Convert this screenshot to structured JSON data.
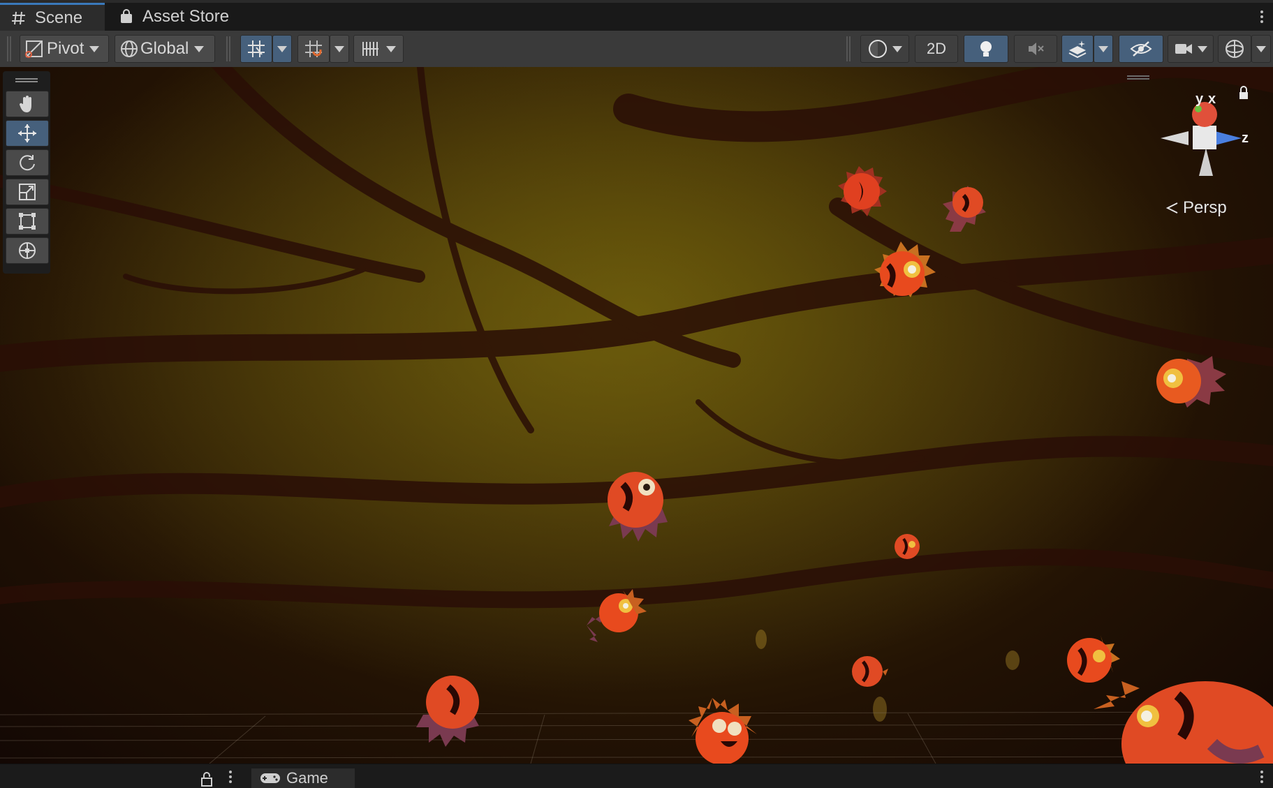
{
  "tabs": [
    {
      "label": "Scene",
      "icon": "hash-icon",
      "active": true
    },
    {
      "label": "Asset Store",
      "icon": "shopping-bag-icon",
      "active": false
    }
  ],
  "toolbar": {
    "pivot_label": "Pivot",
    "global_label": "Global",
    "two_d_label": "2D"
  },
  "scene": {
    "projection_label": "Persp",
    "gizmo_axes": {
      "y": "y",
      "x": "x",
      "z": "z"
    }
  },
  "bottom": {
    "game_tab_label": "Game"
  },
  "colors": {
    "accent_blue": "#46607c",
    "tab_highlight": "#3a79bb"
  }
}
